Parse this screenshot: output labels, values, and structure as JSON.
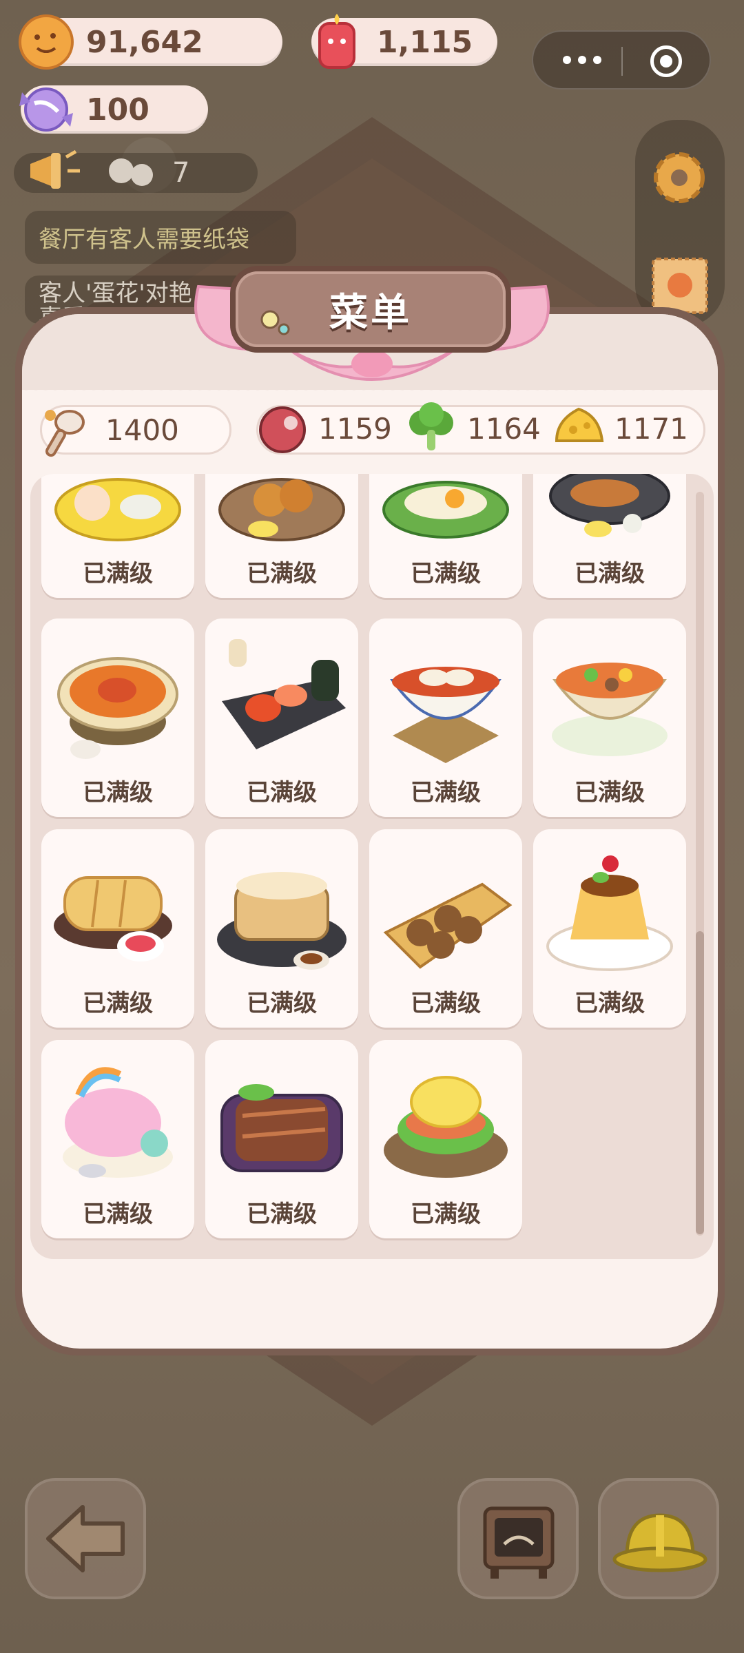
{
  "currencies": {
    "coins": "91,642",
    "gems": "1,115",
    "candy": "100"
  },
  "guests": {
    "count": "7"
  },
  "notices": [
    "餐厅有客人需要纸袋",
    "客人'蛋花'对艳",
    "喜爱"
  ],
  "panel": {
    "title": "菜单",
    "resources": [
      {
        "icon": "spoon-icon",
        "value": "1400"
      },
      {
        "icon": "meat-icon",
        "value": "1159"
      },
      {
        "icon": "broccoli-icon",
        "value": "1164"
      },
      {
        "icon": "cheese-icon",
        "value": "1171"
      }
    ]
  },
  "dishes": [
    {
      "icon": "bento-icon",
      "status": "已满级"
    },
    {
      "icon": "fried-chicken-icon",
      "status": "已满级"
    },
    {
      "icon": "leaf-dish-icon",
      "status": "已满级"
    },
    {
      "icon": "grill-plate-icon",
      "status": "已满级"
    },
    {
      "icon": "crab-stew-icon",
      "status": "已满级"
    },
    {
      "icon": "sushi-icon",
      "status": "已满级"
    },
    {
      "icon": "dumpling-soup-icon",
      "status": "已满级"
    },
    {
      "icon": "veggie-bowl-icon",
      "status": "已满级"
    },
    {
      "icon": "bread-loaf-icon",
      "status": "已满级"
    },
    {
      "icon": "steamed-bun-icon",
      "status": "已满级"
    },
    {
      "icon": "takoyaki-icon",
      "status": "已满级"
    },
    {
      "icon": "pudding-icon",
      "status": "已满级"
    },
    {
      "icon": "rainbow-cake-icon",
      "status": "已满级"
    },
    {
      "icon": "grilled-eel-icon",
      "status": "已满级"
    },
    {
      "icon": "eggs-benedict-icon",
      "status": "已满级"
    }
  ],
  "colors": {
    "panel_border": "#7a5e52",
    "panel_bg": "#fbf2ee",
    "title_ribbon": "#f2a9c4",
    "label_text": "#5a4438"
  }
}
